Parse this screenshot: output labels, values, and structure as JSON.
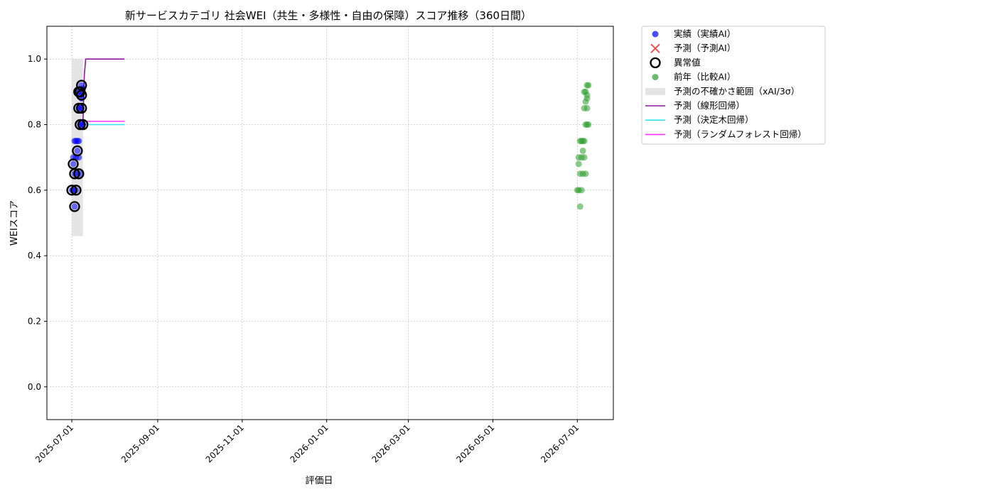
{
  "chart_data": {
    "type": "scatter",
    "title": "新サービスカテゴリ 社会WEI（共生・多様性・自由の保障）スコア推移（360日間）",
    "xlabel": "評価日",
    "ylabel": "WEIスコア",
    "ylim": [
      -0.1,
      1.1
    ],
    "yticks": [
      0.0,
      0.2,
      0.4,
      0.6,
      0.8,
      1.0
    ],
    "xlim": [
      "2025-06-13",
      "2026-07-27"
    ],
    "xticks": [
      "2025-07-01",
      "2025-09-01",
      "2025-11-01",
      "2026-01-01",
      "2026-03-01",
      "2026-05-01",
      "2026-07-01"
    ],
    "grid": true,
    "legend_position": "outside-top-right",
    "series": [
      {
        "name": "実績（実績AI）",
        "kind": "scatter",
        "color": "#0000ff",
        "points": [
          [
            "2025-07-01",
            0.6
          ],
          [
            "2025-07-02",
            0.68
          ],
          [
            "2025-07-02",
            0.6
          ],
          [
            "2025-07-02",
            0.7
          ],
          [
            "2025-07-03",
            0.75
          ],
          [
            "2025-07-03",
            0.65
          ],
          [
            "2025-07-03",
            0.55
          ],
          [
            "2025-07-04",
            0.6
          ],
          [
            "2025-07-04",
            0.7
          ],
          [
            "2025-07-04",
            0.75
          ],
          [
            "2025-07-05",
            0.72
          ],
          [
            "2025-07-05",
            0.65
          ],
          [
            "2025-07-05",
            0.75
          ],
          [
            "2025-07-06",
            0.85
          ],
          [
            "2025-07-06",
            0.9
          ],
          [
            "2025-07-06",
            0.7
          ],
          [
            "2025-07-06",
            0.75
          ],
          [
            "2025-07-07",
            0.9
          ],
          [
            "2025-07-07",
            0.65
          ],
          [
            "2025-07-07",
            0.8
          ],
          [
            "2025-07-07",
            0.85
          ],
          [
            "2025-07-08",
            0.92
          ],
          [
            "2025-07-08",
            0.88
          ],
          [
            "2025-07-08",
            0.8
          ],
          [
            "2025-07-08",
            0.85
          ],
          [
            "2025-07-08",
            0.89
          ],
          [
            "2025-07-09",
            0.91
          ],
          [
            "2025-07-09",
            0.8
          ]
        ]
      },
      {
        "name": "予測（予測AI）",
        "kind": "cross",
        "color": "#ff4040",
        "points": []
      },
      {
        "name": "異常値",
        "kind": "ring",
        "color": "#000000",
        "points": [
          [
            "2025-07-01",
            0.6
          ],
          [
            "2025-07-02",
            0.68
          ],
          [
            "2025-07-03",
            0.65
          ],
          [
            "2025-07-03",
            0.55
          ],
          [
            "2025-07-04",
            0.6
          ],
          [
            "2025-07-05",
            0.72
          ],
          [
            "2025-07-06",
            0.65
          ],
          [
            "2025-07-06",
            0.85
          ],
          [
            "2025-07-06",
            0.9
          ],
          [
            "2025-07-07",
            0.8
          ],
          [
            "2025-07-07",
            0.9
          ],
          [
            "2025-07-08",
            0.92
          ],
          [
            "2025-07-08",
            0.89
          ],
          [
            "2025-07-08",
            0.85
          ],
          [
            "2025-07-09",
            0.8
          ]
        ]
      },
      {
        "name": "前年（比較AI）",
        "kind": "scatter",
        "color": "#2e9e2e",
        "points": [
          [
            "2026-07-01",
            0.6
          ],
          [
            "2026-07-02",
            0.68
          ],
          [
            "2026-07-02",
            0.6
          ],
          [
            "2026-07-02",
            0.7
          ],
          [
            "2026-07-03",
            0.75
          ],
          [
            "2026-07-03",
            0.65
          ],
          [
            "2026-07-03",
            0.55
          ],
          [
            "2026-07-04",
            0.6
          ],
          [
            "2026-07-04",
            0.7
          ],
          [
            "2026-07-04",
            0.75
          ],
          [
            "2026-07-05",
            0.72
          ],
          [
            "2026-07-05",
            0.65
          ],
          [
            "2026-07-05",
            0.75
          ],
          [
            "2026-07-06",
            0.85
          ],
          [
            "2026-07-06",
            0.9
          ],
          [
            "2026-07-06",
            0.7
          ],
          [
            "2026-07-06",
            0.75
          ],
          [
            "2026-07-07",
            0.9
          ],
          [
            "2026-07-07",
            0.65
          ],
          [
            "2026-07-07",
            0.8
          ],
          [
            "2026-07-07",
            0.87
          ],
          [
            "2026-07-08",
            0.92
          ],
          [
            "2026-07-08",
            0.88
          ],
          [
            "2026-07-08",
            0.8
          ],
          [
            "2026-07-08",
            0.85
          ],
          [
            "2026-07-08",
            0.89
          ],
          [
            "2026-07-09",
            0.92
          ],
          [
            "2026-07-09",
            0.8
          ]
        ]
      },
      {
        "name": "予測の不確かさ範囲（xAI/3σ）",
        "kind": "band",
        "color": "#d9d9d9",
        "x_range": [
          "2025-07-01",
          "2025-07-09"
        ],
        "y_range": [
          0.46,
          1.0
        ]
      },
      {
        "name": "予測（線形回帰）",
        "kind": "line",
        "color": "#8b1a9c",
        "points": [
          [
            "2025-07-09",
            0.8
          ],
          [
            "2025-07-10",
            0.95
          ],
          [
            "2025-07-11",
            1.0
          ],
          [
            "2025-08-08",
            1.0
          ]
        ]
      },
      {
        "name": "予測（決定木回帰）",
        "kind": "line",
        "color": "#33e6f0",
        "points": [
          [
            "2025-07-09",
            0.8
          ],
          [
            "2025-08-08",
            0.8
          ]
        ]
      },
      {
        "name": "予測（ランダムフォレスト回帰）",
        "kind": "line",
        "color": "#ff33ff",
        "points": [
          [
            "2025-07-09",
            0.81
          ],
          [
            "2025-08-08",
            0.81
          ]
        ]
      }
    ]
  }
}
